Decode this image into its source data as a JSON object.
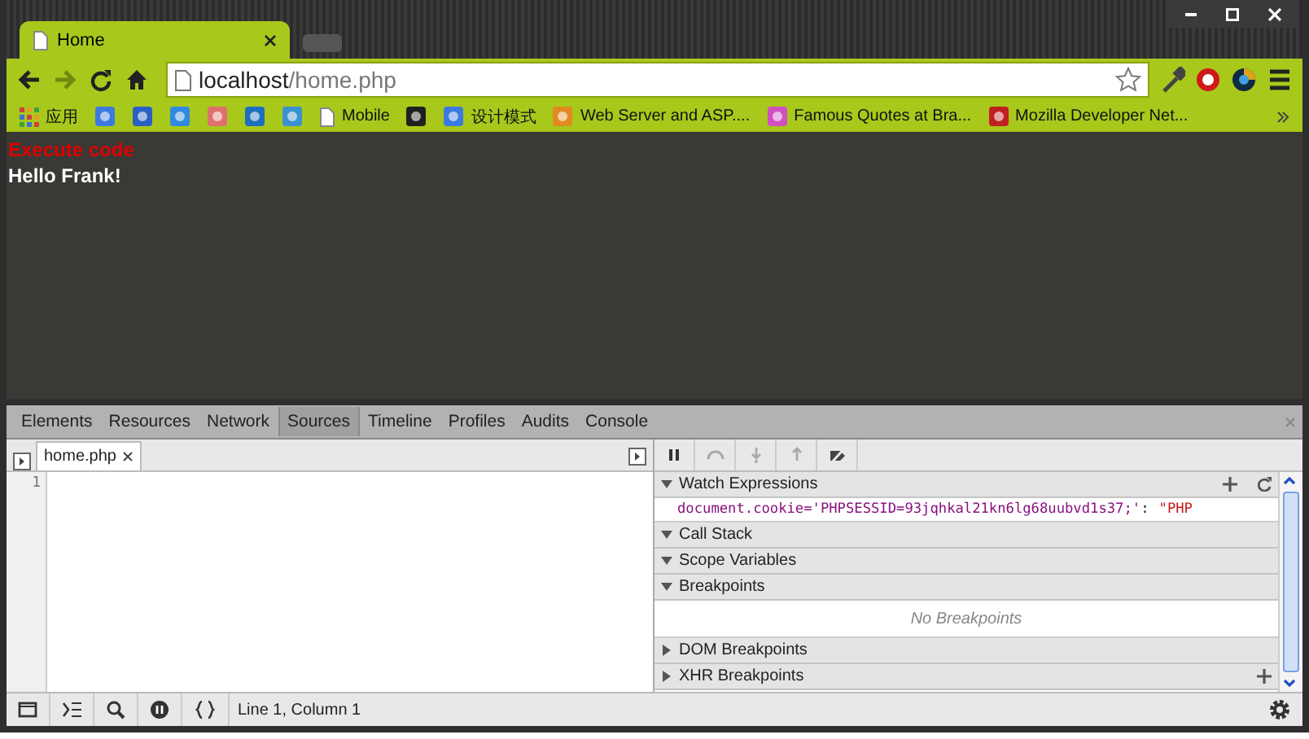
{
  "tabs": [
    {
      "title": "Home",
      "selected": true
    }
  ],
  "address": {
    "host": "localhost",
    "path": "/home.php"
  },
  "bookmarks": [
    {
      "kind": "folder",
      "label": "应用"
    },
    {
      "kind": "icon",
      "color": "#3b7be0"
    },
    {
      "kind": "icon",
      "color": "#2a5fc4"
    },
    {
      "kind": "icon",
      "color": "#2f8ae0"
    },
    {
      "kind": "icon",
      "color": "#e07070"
    },
    {
      "kind": "icon",
      "color": "#1f6fc0"
    },
    {
      "kind": "icon",
      "color": "#3a90d0"
    },
    {
      "kind": "page",
      "label": "Mobile"
    },
    {
      "kind": "icon",
      "color": "#202020"
    },
    {
      "kind": "site",
      "label": "设计模式",
      "color": "#3b7be0"
    },
    {
      "kind": "site",
      "label": "Web Server and ASP....",
      "color": "#e08a20"
    },
    {
      "kind": "site",
      "label": "Famous Quotes at Bra...",
      "color": "#d050c0"
    },
    {
      "kind": "site",
      "label": "Mozilla Developer Net...",
      "color": "#c02020"
    }
  ],
  "page": {
    "link": "Execute code",
    "greeting": "Hello Frank!"
  },
  "devtools": {
    "tabs": [
      {
        "label": "Elements",
        "selected": false
      },
      {
        "label": "Resources",
        "selected": false
      },
      {
        "label": "Network",
        "selected": false
      },
      {
        "label": "Sources",
        "selected": true
      },
      {
        "label": "Timeline",
        "selected": false
      },
      {
        "label": "Profiles",
        "selected": false
      },
      {
        "label": "Audits",
        "selected": false
      },
      {
        "label": "Console",
        "selected": false
      }
    ],
    "file_tabs": [
      {
        "label": "home.php",
        "selected": true
      }
    ],
    "line_numbers": [
      "1"
    ],
    "status": "Line 1, Column 1",
    "sections": [
      {
        "title": "Watch Expressions",
        "expanded": true,
        "kind": "watch",
        "expression": "document.cookie='PHPSESSID=93jqhkal21kn6lg68uubvd1s37;'",
        "separator": ":",
        "value": "\"PHP"
      },
      {
        "title": "Call Stack",
        "expanded": true,
        "kind": "plain"
      },
      {
        "title": "Scope Variables",
        "expanded": true,
        "kind": "plain"
      },
      {
        "title": "Breakpoints",
        "expanded": true,
        "kind": "message",
        "message": "No Breakpoints"
      },
      {
        "title": "DOM Breakpoints",
        "expanded": false,
        "kind": "plain"
      },
      {
        "title": "XHR Breakpoints",
        "expanded": false,
        "kind": "add"
      }
    ]
  }
}
